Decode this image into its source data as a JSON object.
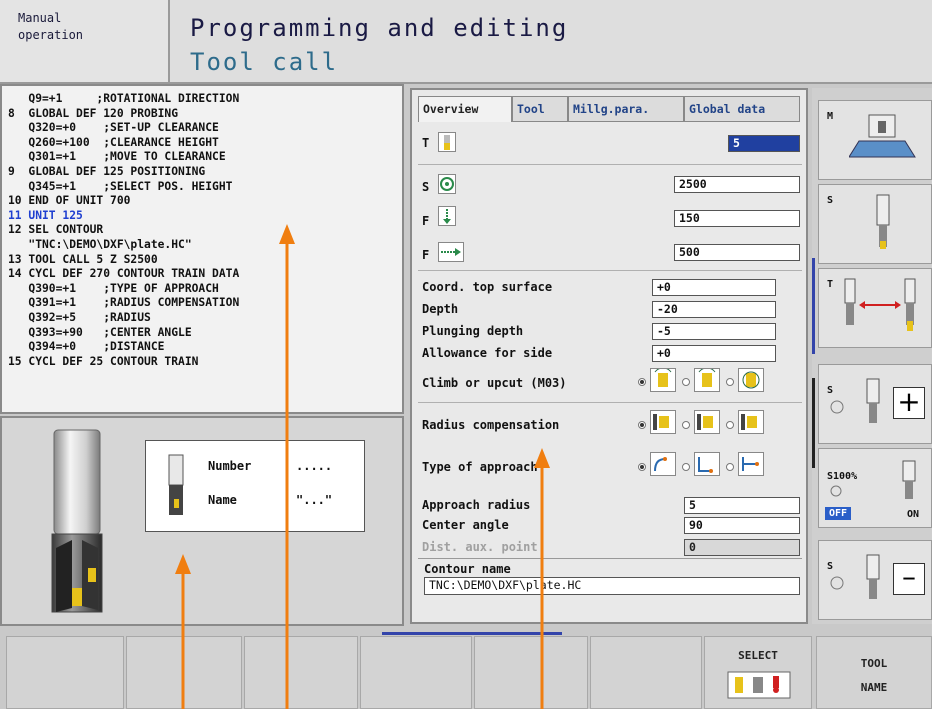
{
  "header": {
    "mode_label_line1": "Manual",
    "mode_label_line2": "operation",
    "title": "Programming and editing",
    "subtitle": "Tool call"
  },
  "program": {
    "lines": [
      "   Q9=+1     ;ROTATIONAL DIRECTION",
      "8  GLOBAL DEF 120 PROBING",
      "   Q320=+0    ;SET-UP CLEARANCE",
      "   Q260=+100  ;CLEARANCE HEIGHT",
      "   Q301=+1    ;MOVE TO CLEARANCE",
      "9  GLOBAL DEF 125 POSITIONING",
      "   Q345=+1    ;SELECT POS. HEIGHT",
      "10 END OF UNIT 700",
      "11 UNIT 125",
      "12 SEL CONTOUR",
      "   \"TNC:\\DEMO\\DXF\\plate.HC\"",
      "13 TOOL CALL 5 Z S2500",
      "14 CYCL DEF 270 CONTOUR TRAIN DATA",
      "   Q390=+1    ;TYPE OF APPROACH",
      "   Q391=+1    ;RADIUS COMPENSATION",
      "   Q392=+5    ;RADIUS",
      "   Q393=+90   ;CENTER ANGLE",
      "   Q394=+0    ;DISTANCE",
      "15 CYCL DEF 25 CONTOUR TRAIN"
    ],
    "highlighted_line": "11 UNIT 125"
  },
  "tool_info": {
    "number_label": "Number",
    "number_value": ".....",
    "name_label": "Name",
    "name_value": "\"...\""
  },
  "tabs": [
    "Overview",
    "Tool",
    "Millg.para.",
    "Global data"
  ],
  "form": {
    "t_label": "T",
    "t_value": "5",
    "s_label": "S",
    "s_value": "2500",
    "f1_label": "F",
    "f1_value": "150",
    "f2_label": "F",
    "f2_value": "500",
    "coord_label": "Coord. top surface",
    "coord_value": "+0",
    "depth_label": "Depth",
    "depth_value": "-20",
    "plunge_label": "Plunging depth",
    "plunge_value": "-5",
    "allow_label": "Allowance for side",
    "allow_value": "+0",
    "climb_label": "Climb or upcut (M03)",
    "radcomp_label": "Radius compensation",
    "approach_type_label": "Type of approach",
    "approach_radius_label": "Approach radius",
    "approach_radius_value": "5",
    "center_angle_label": "Center angle",
    "center_angle_value": "90",
    "dist_label": "Dist. aux. point",
    "dist_value": "0",
    "contour_name_label": "Contour name",
    "contour_name_value": "TNC:\\DEMO\\DXF\\plate.HC"
  },
  "softkeys_right": {
    "m_label": "M",
    "s_label": "S",
    "t_label": "T",
    "s_plus_label": "S",
    "s100_label": "S100%",
    "off_label": "OFF",
    "on_label": "ON",
    "s_minus_label": "S"
  },
  "softkeys_bottom": {
    "select_label": "SELECT",
    "toolname_line1": "TOOL",
    "toolname_line2": "NAME"
  },
  "colors": {
    "arrow": "#f07e10",
    "highlight_blue": "#1f3fd0",
    "title_blue": "#2d6b8b"
  }
}
